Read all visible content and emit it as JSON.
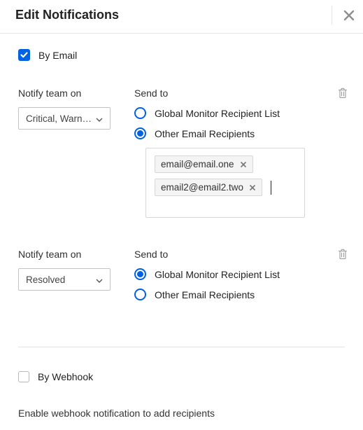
{
  "header": {
    "title": "Edit Notifications"
  },
  "email": {
    "checkbox_label": "By Email",
    "checked": true,
    "blocks": [
      {
        "notify_label": "Notify team on",
        "select_value": "Critical, Warn…",
        "send_label": "Send to",
        "radios": [
          {
            "label": "Global Monitor Recipient List",
            "selected": false
          },
          {
            "label": "Other Email Recipients",
            "selected": true
          }
        ],
        "emails": [
          "email@email.one",
          "email2@email2.two"
        ]
      },
      {
        "notify_label": "Notify team on",
        "select_value": "Resolved",
        "send_label": "Send to",
        "radios": [
          {
            "label": "Global Monitor Recipient List",
            "selected": true
          },
          {
            "label": "Other Email Recipients",
            "selected": false
          }
        ],
        "emails": []
      }
    ]
  },
  "webhook": {
    "checkbox_label": "By Webhook",
    "checked": false,
    "hint": "Enable webhook notification to add recipients"
  },
  "colors": {
    "accent": "#0062e1",
    "border": "#d7d7d7",
    "text": "#303030"
  }
}
